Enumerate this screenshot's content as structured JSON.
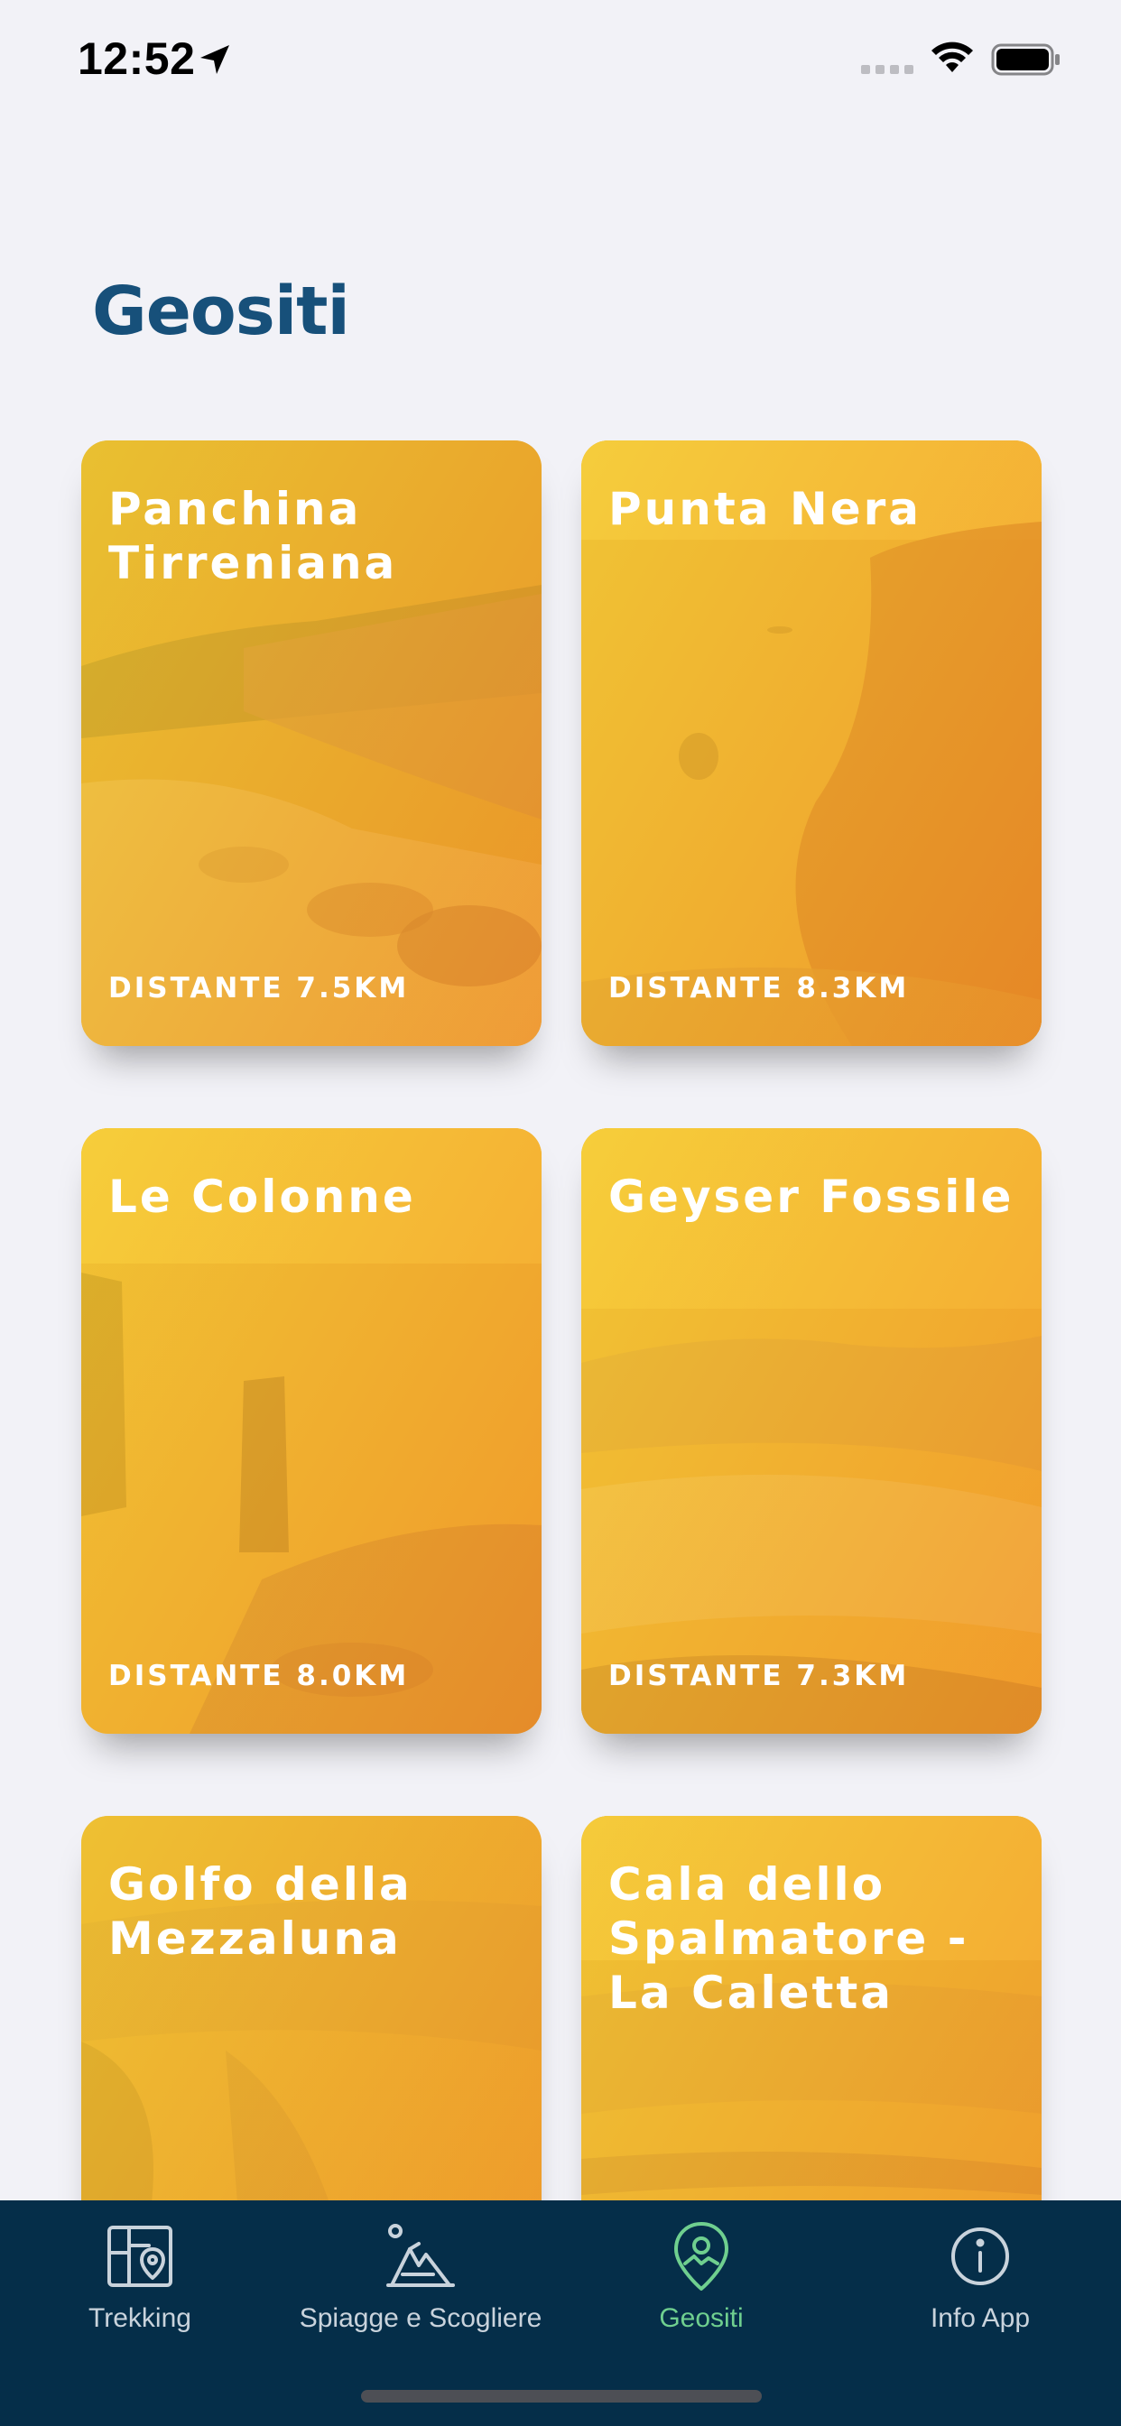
{
  "status_bar": {
    "time": "12:52"
  },
  "page": {
    "title": "Geositi"
  },
  "cards": [
    {
      "title": "Panchina Tirreniana",
      "distance": "DISTANTE 7.5KM"
    },
    {
      "title": "Punta Nera",
      "distance": "DISTANTE 8.3KM"
    },
    {
      "title": "Le Colonne",
      "distance": "DISTANTE 8.0KM"
    },
    {
      "title": "Geyser Fossile",
      "distance": "DISTANTE 7.3KM"
    },
    {
      "title": "Golfo della Mezzaluna",
      "distance": ""
    },
    {
      "title": "Cala dello Spalmatore - La Caletta",
      "distance": ""
    }
  ],
  "tab_bar": {
    "tabs": [
      {
        "label": "Trekking",
        "icon": "trail-map-icon",
        "active": false
      },
      {
        "label": "Spiagge e Scogliere",
        "icon": "cliff-icon",
        "active": false
      },
      {
        "label": "Geositi",
        "icon": "geo-pin-icon",
        "active": true
      },
      {
        "label": "Info App",
        "icon": "info-icon",
        "active": false
      }
    ]
  },
  "colors": {
    "title": "#17507a",
    "card_gradient_start": "#f7d43a",
    "card_gradient_end": "#f58a2a",
    "tab_bar_bg": "#052e49",
    "tab_active": "#6fcf8f",
    "tab_inactive": "#c9d3dc"
  }
}
